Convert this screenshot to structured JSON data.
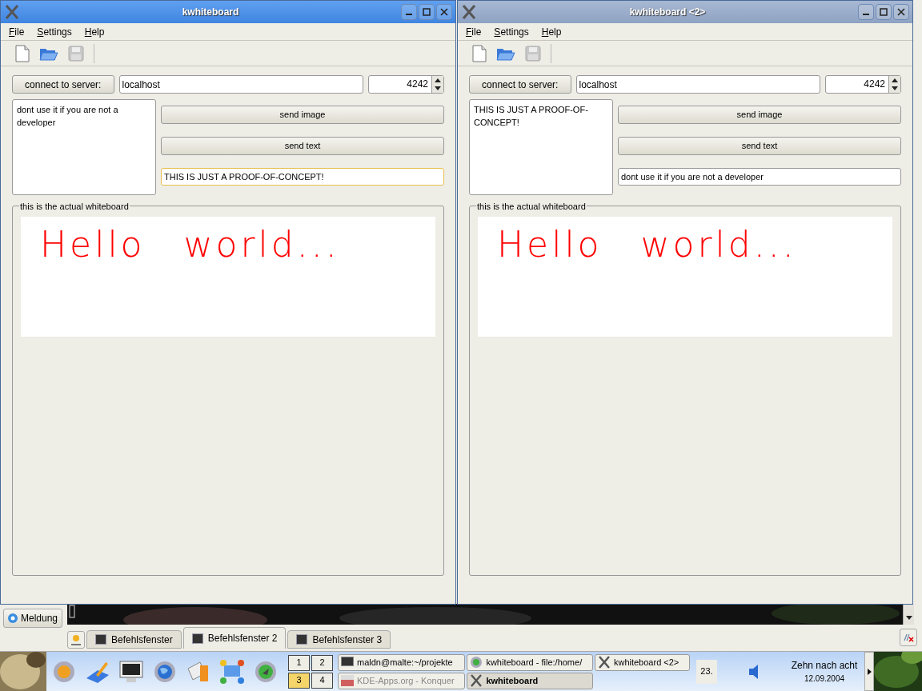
{
  "windows": [
    {
      "title": "kwhiteboard",
      "active": true,
      "menu": [
        "File",
        "Settings",
        "Help"
      ],
      "toolbar": [
        {
          "kind": "new",
          "disabled": false
        },
        {
          "kind": "open",
          "disabled": false
        },
        {
          "kind": "save",
          "disabled": true
        }
      ],
      "connect_button": "connect to server:",
      "host": "localhost",
      "port": "4242",
      "notes": "dont use it if you are not a developer",
      "send_image_button": "send image",
      "send_text_button": "send text",
      "message": {
        "value": "THIS IS JUST A PROOF-OF-CONCEPT!",
        "focused": true
      },
      "whiteboard": {
        "label": "this is the actual whiteboard",
        "handwriting": "Hello world..."
      }
    },
    {
      "title": "kwhiteboard <2>",
      "active": false,
      "menu": [
        "File",
        "Settings",
        "Help"
      ],
      "toolbar": [
        {
          "kind": "new",
          "disabled": false
        },
        {
          "kind": "open",
          "disabled": false
        },
        {
          "kind": "save",
          "disabled": true
        }
      ],
      "connect_button": "connect to server:",
      "host": "localhost",
      "port": "4242",
      "notes": "THIS IS JUST A PROOF-OF-CONCEPT!",
      "send_image_button": "send image",
      "send_text_button": "send text",
      "message": {
        "value": "dont use it if you are not a developer",
        "focused": false
      },
      "whiteboard": {
        "label": "this is the actual whiteboard",
        "handwriting": "Hello world..."
      }
    }
  ],
  "konsole": {
    "side_button": "Meldung",
    "tabs": [
      {
        "label": "Befehlsfenster",
        "selected": false
      },
      {
        "label": "Befehlsfenster 2",
        "selected": true
      },
      {
        "label": "Befehlsfenster 3",
        "selected": false
      }
    ]
  },
  "taskbar": {
    "pager": [
      {
        "label": "1",
        "selected": false
      },
      {
        "label": "2",
        "selected": false
      },
      {
        "label": "3",
        "selected": true
      },
      {
        "label": "4",
        "selected": false
      }
    ],
    "tasks": [
      {
        "label": "maldn@malte:~/projekte",
        "kind": "terminal",
        "active": false,
        "minimized": false
      },
      {
        "label": "KDE-Apps.org - Konquer",
        "kind": "kde",
        "active": false,
        "minimized": true
      },
      {
        "label": "kwhiteboard - file:/home/",
        "kind": "browser",
        "active": false,
        "minimized": false
      },
      {
        "label": "kwhiteboard",
        "kind": "x",
        "active": true,
        "minimized": false
      },
      {
        "label": "kwhiteboard <2>",
        "kind": "x",
        "active": false,
        "minimized": false
      }
    ],
    "applet": "23.",
    "clock": {
      "time": "Zehn nach acht",
      "date": "12.09.2004"
    }
  }
}
